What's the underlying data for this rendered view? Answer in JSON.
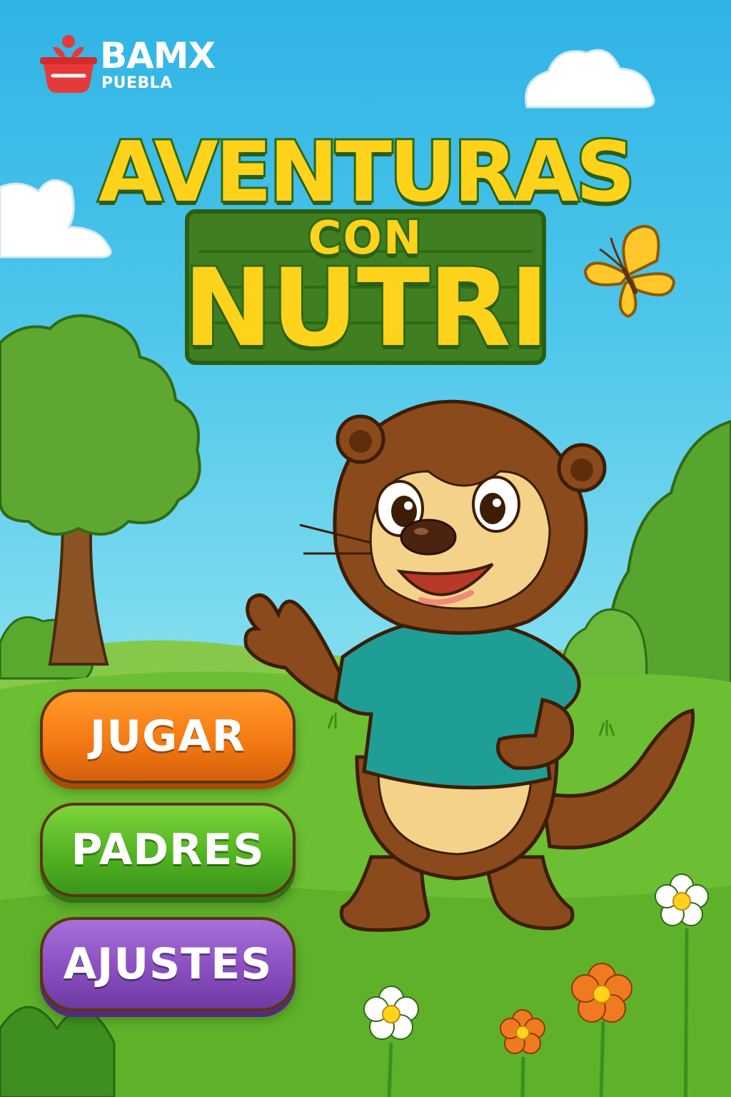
{
  "brand": {
    "name": "BAMX",
    "city": "PUEBLA",
    "colors": {
      "mark": "#e63a3a",
      "text": "#ffffff"
    }
  },
  "title": {
    "line1": "AVENTURAS",
    "line2": "CON",
    "line3": "NUTRI",
    "colors": {
      "fill": "#ffd21c",
      "outline": "#2f6b14",
      "board": "#3f7f22"
    }
  },
  "menu": {
    "play_label": "JUGAR",
    "parents_label": "PADRES",
    "settings_label": "AJUSTES",
    "colors": {
      "play": "#f57a14",
      "parents": "#52b322",
      "settings": "#8a4fc0"
    }
  },
  "mascot": {
    "character": "otter",
    "shirt_color": "#1f9e96"
  },
  "scene": {
    "sky_color": "#2fb4e6",
    "grass_color": "#6cbf32",
    "icons": [
      "cloud-icon",
      "butterfly-icon",
      "tree-icon",
      "bush-icon",
      "flower-icon"
    ]
  }
}
